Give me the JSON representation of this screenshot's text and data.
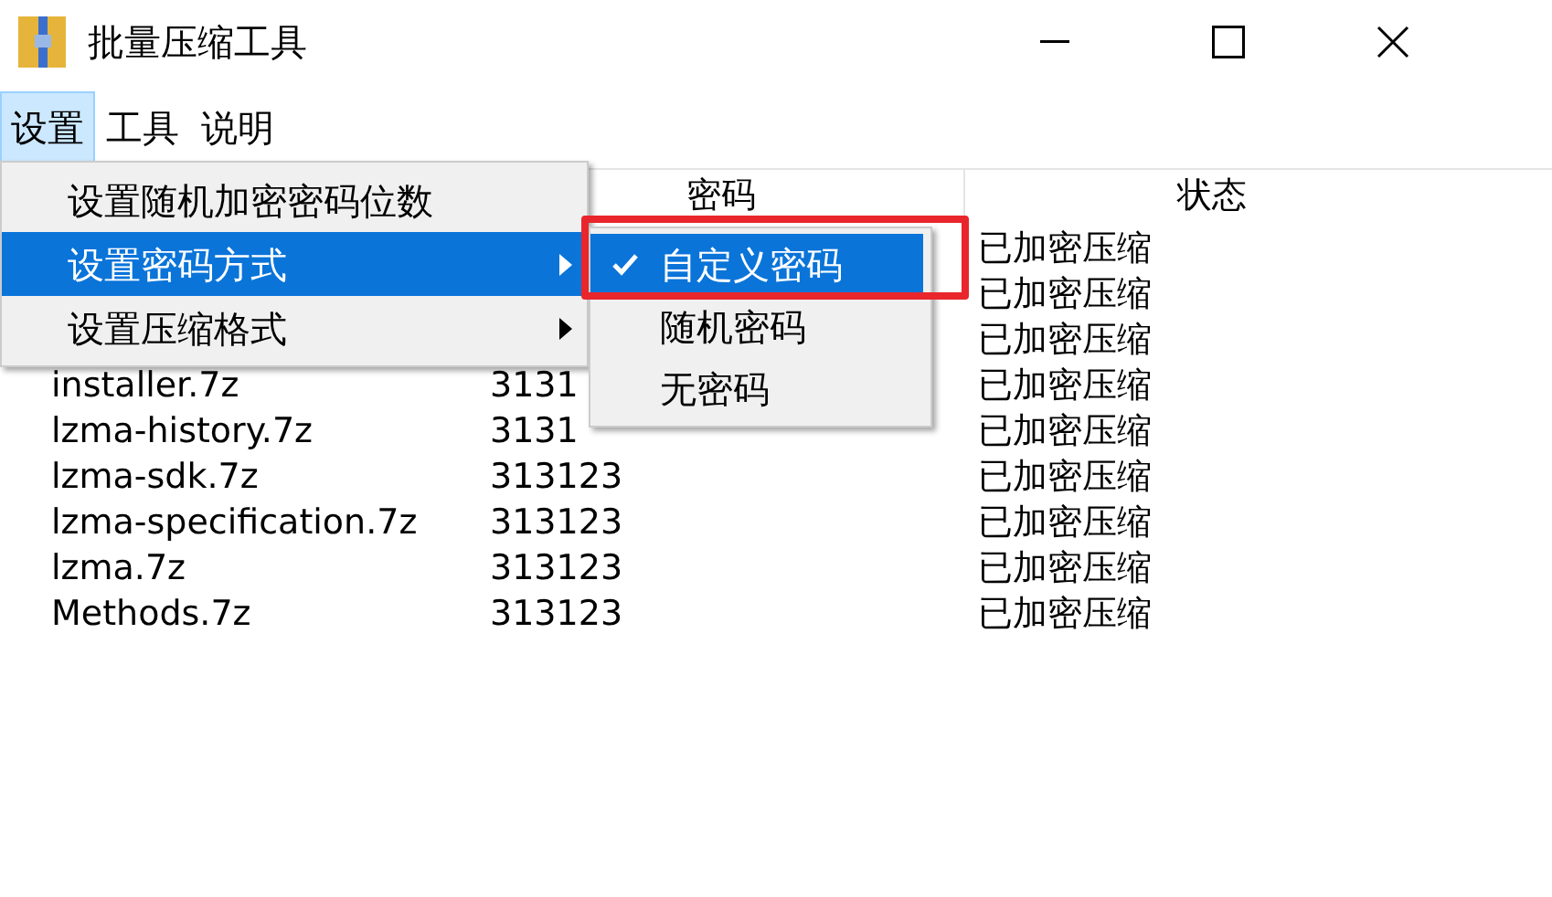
{
  "window": {
    "title": "批量压缩工具"
  },
  "menu_bar": [
    {
      "label": "设置",
      "selected": true
    },
    {
      "label": "工具",
      "selected": false
    },
    {
      "label": "说明",
      "selected": false
    }
  ],
  "dropdown": [
    {
      "label": "设置随机加密密码位数",
      "selected": false,
      "has_submenu": false
    },
    {
      "label": "设置密码方式",
      "selected": true,
      "has_submenu": true
    },
    {
      "label": "设置压缩格式",
      "selected": false,
      "has_submenu": true
    }
  ],
  "submenu": [
    {
      "label": "自定义密码",
      "selected": true,
      "checked": true
    },
    {
      "label": "随机密码",
      "selected": false,
      "checked": false
    },
    {
      "label": "无密码",
      "selected": false,
      "checked": false
    }
  ],
  "list": {
    "columns": [
      {
        "label": "密码"
      },
      {
        "label": "状态"
      }
    ],
    "rows": [
      {
        "status": "已加密压缩"
      },
      {
        "status": "已加密压缩"
      },
      {
        "status": "已加密压缩"
      },
      {
        "name": "installer.7z",
        "password": "3131",
        "status": "已加密压缩"
      },
      {
        "name": "lzma-history.7z",
        "password": "3131",
        "status": "已加密压缩"
      },
      {
        "name": "lzma-sdk.7z",
        "password": "313123",
        "status": "已加密压缩"
      },
      {
        "name": "lzma-specification.7z",
        "password": "313123",
        "status": "已加密压缩"
      },
      {
        "name": "lzma.7z",
        "password": "313123",
        "status": "已加密压缩"
      },
      {
        "name": "Methods.7z",
        "password": "313123",
        "status": "已加密压缩"
      }
    ]
  }
}
